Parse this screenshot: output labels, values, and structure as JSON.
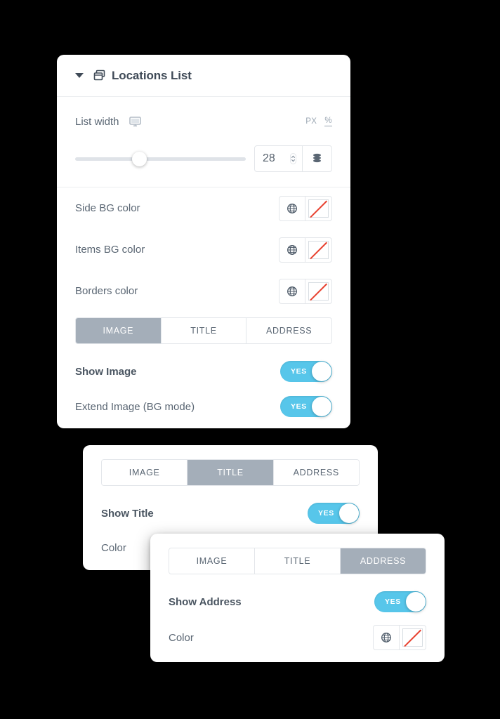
{
  "card1": {
    "title": "Locations List",
    "icons": {
      "collapse": "caret-down-icon",
      "panel": "windows-stack-icon"
    },
    "list_width": {
      "label": "List width",
      "device_icon": "desktop-monitor-icon",
      "units": [
        {
          "label": "PX",
          "active": false
        },
        {
          "label": "%",
          "active": true
        }
      ],
      "value": "28",
      "slider_percent": 33.5,
      "dynamic_icon": "database-icon",
      "spinner_icon": "spinner-up-down-icon"
    },
    "colors": [
      {
        "label": "Side BG color",
        "globe_icon": "globe-icon",
        "swatch": "none"
      },
      {
        "label": "Items BG color",
        "globe_icon": "globe-icon",
        "swatch": "none"
      },
      {
        "label": "Borders color",
        "globe_icon": "globe-icon",
        "swatch": "none"
      }
    ],
    "tabs": [
      {
        "label": "IMAGE",
        "active": true
      },
      {
        "label": "TITLE",
        "active": false
      },
      {
        "label": "ADDRESS",
        "active": false
      }
    ],
    "switches": [
      {
        "label": "Show Image",
        "value": "YES",
        "bold": true
      },
      {
        "label": "Extend Image (BG mode)",
        "value": "YES",
        "bold": false
      }
    ]
  },
  "card2": {
    "tabs": [
      {
        "label": "IMAGE",
        "active": false
      },
      {
        "label": "TITLE",
        "active": true
      },
      {
        "label": "ADDRESS",
        "active": false
      }
    ],
    "switch": {
      "label": "Show Title",
      "value": "YES"
    },
    "color_row": {
      "label": "Color"
    }
  },
  "card3": {
    "tabs": [
      {
        "label": "IMAGE",
        "active": false
      },
      {
        "label": "TITLE",
        "active": false
      },
      {
        "label": "ADDRESS",
        "active": true
      }
    ],
    "switch": {
      "label": "Show Address",
      "value": "YES"
    },
    "color_row": {
      "label": "Color",
      "globe_icon": "globe-icon",
      "swatch": "none"
    }
  },
  "colors": {
    "background": "#000000",
    "card": "#ffffff",
    "accent_switch": "#57c6ea",
    "tab_active": "#a4aeb9",
    "text": "#5a6673",
    "title": "#3f4a57",
    "swatch_slash": "#e8412f"
  }
}
